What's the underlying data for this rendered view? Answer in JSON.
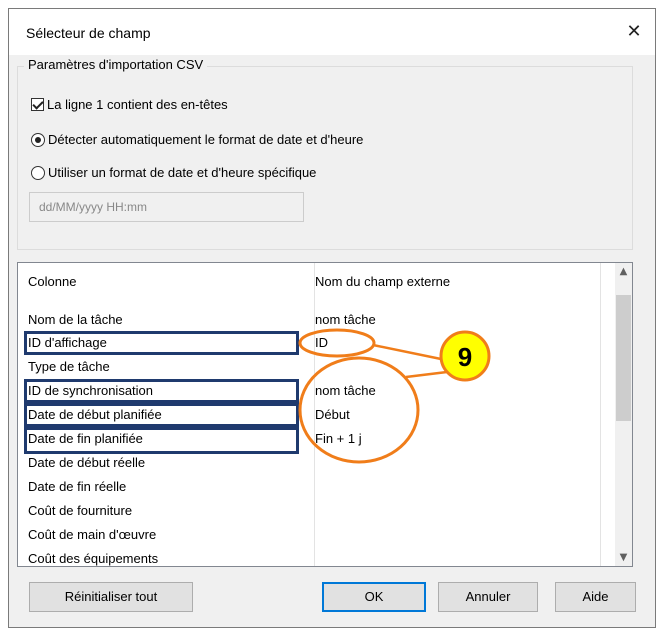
{
  "dialog": {
    "title": "Sélecteur de champ",
    "close_icon": "close-icon"
  },
  "csv_settings": {
    "legend": "Paramètres d'importation CSV",
    "headers_checkbox": {
      "label": "La ligne 1 contient des en-têtes",
      "checked": true
    },
    "auto_detect_radio": {
      "label": "Détecter automatiquement le format de date et d'heure",
      "selected": true
    },
    "specific_format_radio": {
      "label": "Utiliser un format de date et d'heure spécifique",
      "selected": false
    },
    "format_input": {
      "value": "dd/MM/yyyy HH:mm"
    }
  },
  "mapping_grid": {
    "columns": [
      "Colonne",
      "Nom du champ externe"
    ],
    "rows": [
      {
        "column": "Nom de la tâche",
        "external": "nom tâche"
      },
      {
        "column": "ID d'affichage",
        "external": "ID"
      },
      {
        "column": "Type de tâche",
        "external": ""
      },
      {
        "column": "ID de synchronisation",
        "external": "nom tâche"
      },
      {
        "column": "Date de début planifiée",
        "external": "Début"
      },
      {
        "column": "Date de fin planifiée",
        "external": "Fin + 1 j"
      },
      {
        "column": "Date de début réelle",
        "external": ""
      },
      {
        "column": "Date de fin réelle",
        "external": ""
      },
      {
        "column": "Coût de fourniture",
        "external": ""
      },
      {
        "column": "Coût de main d'œuvre",
        "external": ""
      },
      {
        "column": "Coût des équipements",
        "external": ""
      }
    ]
  },
  "annotation": {
    "badge": "9",
    "color": "#f07d1a",
    "fill": "#ffff00"
  },
  "buttons": {
    "reset": "Réinitialiser tout",
    "ok": "OK",
    "cancel": "Annuler",
    "help": "Aide"
  }
}
